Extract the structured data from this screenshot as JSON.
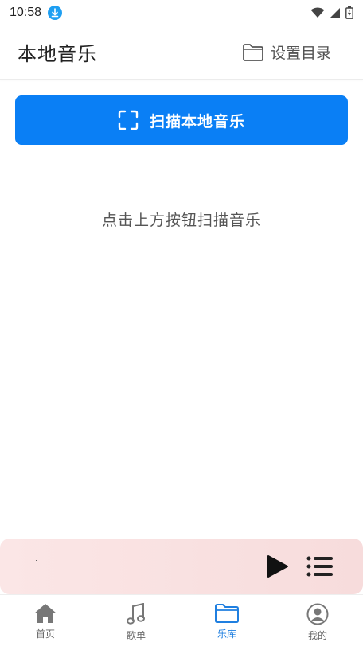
{
  "status_bar": {
    "time": "10:58",
    "icons": [
      "download-icon",
      "wifi-icon",
      "signal-icon",
      "battery-charging-icon"
    ]
  },
  "header": {
    "title": "本地音乐",
    "set_dir_label": "设置目录",
    "set_dir_icon": "folder-icon"
  },
  "scan_button": {
    "label": "扫描本地音乐",
    "icon": "scan-frame-icon",
    "color": "#0a7ff5"
  },
  "empty_hint": "点击上方按钮扫描音乐",
  "player": {
    "play_icon": "play-icon",
    "playlist_icon": "playlist-icon"
  },
  "tabs": [
    {
      "label": "首页",
      "icon": "home-icon",
      "active": false
    },
    {
      "label": "歌单",
      "icon": "music-note-icon",
      "active": false
    },
    {
      "label": "乐库",
      "icon": "folder-icon",
      "active": true
    },
    {
      "label": "我的",
      "icon": "user-circle-icon",
      "active": false
    }
  ],
  "colors": {
    "accent": "#0a7ff5",
    "active_tab": "#1f7fe0",
    "player_bg": "#f9e1e1"
  }
}
